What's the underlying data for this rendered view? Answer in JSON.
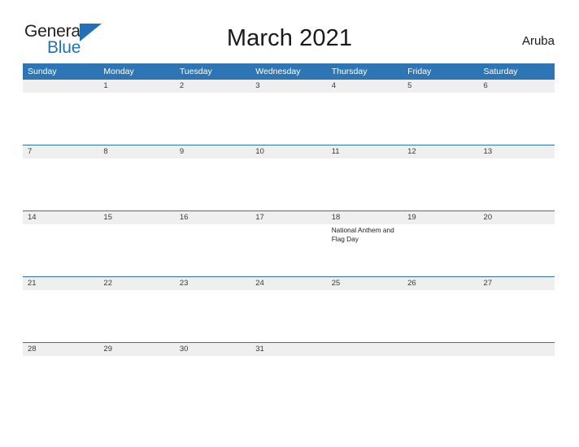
{
  "logo": {
    "word_one": "General",
    "word_two": "Blue",
    "flag_icon": "triangle-flag-icon",
    "color_blue": "#2170b8",
    "color_dark": "#231f20"
  },
  "header": {
    "title": "March 2021",
    "country": "Aruba"
  },
  "calendar": {
    "accent_color": "#2e75b6",
    "band_color": "#efeff0",
    "weekday_headers": [
      "Sunday",
      "Monday",
      "Tuesday",
      "Wednesday",
      "Thursday",
      "Friday",
      "Saturday"
    ],
    "weeks": [
      [
        {
          "day": "",
          "events": []
        },
        {
          "day": "1",
          "events": []
        },
        {
          "day": "2",
          "events": []
        },
        {
          "day": "3",
          "events": []
        },
        {
          "day": "4",
          "events": []
        },
        {
          "day": "5",
          "events": []
        },
        {
          "day": "6",
          "events": []
        }
      ],
      [
        {
          "day": "7",
          "events": []
        },
        {
          "day": "8",
          "events": []
        },
        {
          "day": "9",
          "events": []
        },
        {
          "day": "10",
          "events": []
        },
        {
          "day": "11",
          "events": []
        },
        {
          "day": "12",
          "events": []
        },
        {
          "day": "13",
          "events": []
        }
      ],
      [
        {
          "day": "14",
          "events": []
        },
        {
          "day": "15",
          "events": []
        },
        {
          "day": "16",
          "events": []
        },
        {
          "day": "17",
          "events": []
        },
        {
          "day": "18",
          "events": [
            "National Anthem and Flag Day"
          ]
        },
        {
          "day": "19",
          "events": []
        },
        {
          "day": "20",
          "events": []
        }
      ],
      [
        {
          "day": "21",
          "events": []
        },
        {
          "day": "22",
          "events": []
        },
        {
          "day": "23",
          "events": []
        },
        {
          "day": "24",
          "events": []
        },
        {
          "day": "25",
          "events": []
        },
        {
          "day": "26",
          "events": []
        },
        {
          "day": "27",
          "events": []
        }
      ],
      [
        {
          "day": "28",
          "events": []
        },
        {
          "day": "29",
          "events": []
        },
        {
          "day": "30",
          "events": []
        },
        {
          "day": "31",
          "events": []
        },
        {
          "day": "",
          "events": []
        },
        {
          "day": "",
          "events": []
        },
        {
          "day": "",
          "events": []
        }
      ]
    ]
  }
}
